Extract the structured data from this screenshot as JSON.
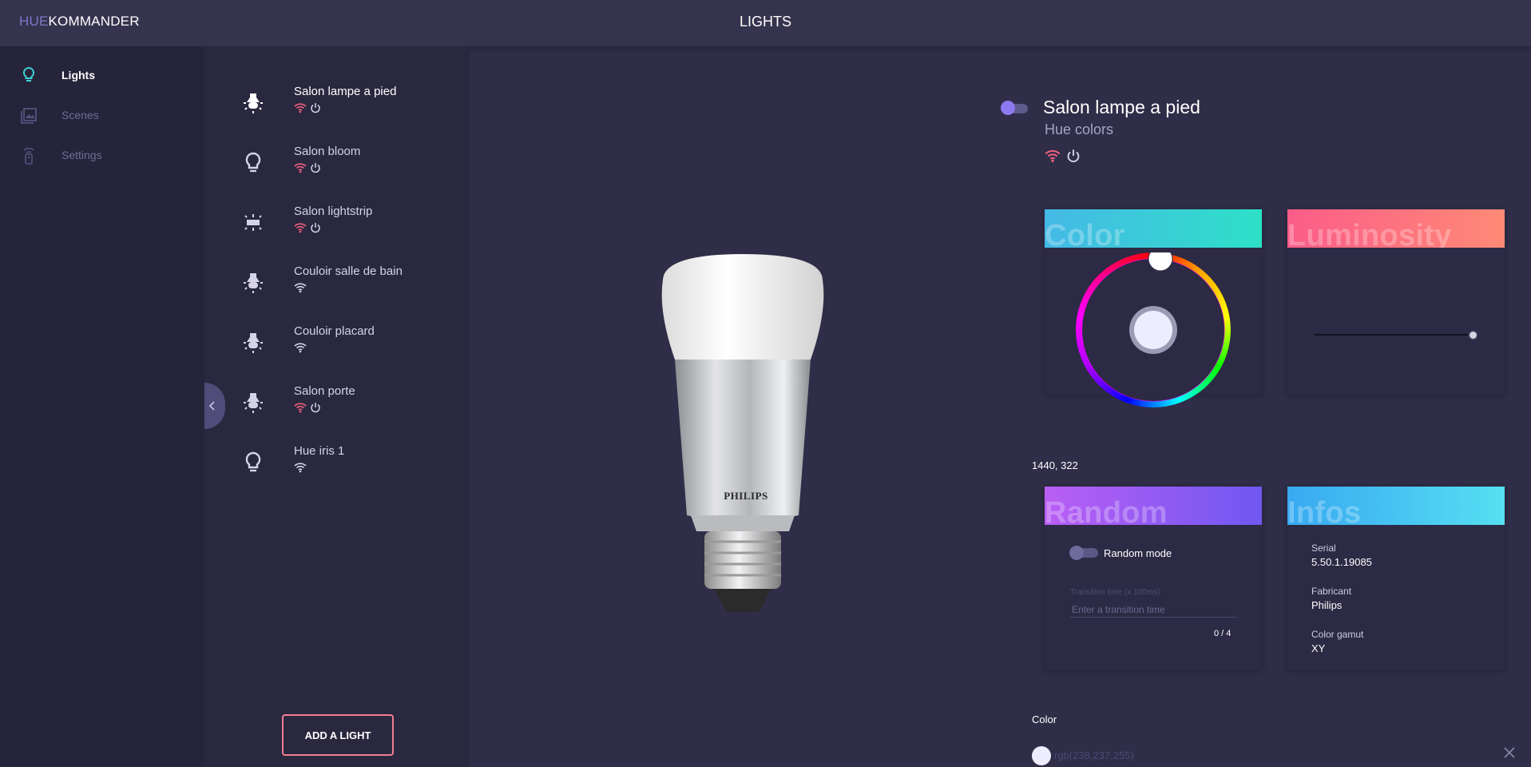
{
  "brand": {
    "prefix": "HUE",
    "name": "KOMMANDER"
  },
  "page_title": "LIGHTS",
  "nav": [
    {
      "label": "Lights",
      "icon": "bulb-icon",
      "active": true
    },
    {
      "label": "Scenes",
      "icon": "image-icon",
      "active": false
    },
    {
      "label": "Settings",
      "icon": "remote-icon",
      "active": false
    }
  ],
  "lights": [
    {
      "name": "Salon lampe a pied",
      "icon": "spot-bulb-icon",
      "reachable": false,
      "power": true
    },
    {
      "name": "Salon bloom",
      "icon": "bulb-outline-icon",
      "reachable": false,
      "power": true
    },
    {
      "name": "Salon lightstrip",
      "icon": "lightstrip-icon",
      "reachable": false,
      "power": true
    },
    {
      "name": "Couloir salle de bain",
      "icon": "spot-bulb-icon",
      "reachable": true,
      "power": false
    },
    {
      "name": "Couloir placard",
      "icon": "spot-bulb-icon",
      "reachable": true,
      "power": false
    },
    {
      "name": "Salon porte",
      "icon": "spot-bulb-icon",
      "reachable": false,
      "power": true
    },
    {
      "name": "Hue iris 1",
      "icon": "bulb-outline-icon",
      "reachable": true,
      "power": false
    }
  ],
  "add_light_label": "ADD A LIGHT",
  "bulb_brand": "PHILIPS",
  "detail": {
    "name": "Salon lampe a pied",
    "type": "Hue colors",
    "on": true
  },
  "cards": {
    "color_title": "Color",
    "luminosity_title": "Luminosity",
    "luminosity_level": 0.97,
    "random_title": "Random",
    "infos_title": "Infos"
  },
  "coords": "1440, 322",
  "random": {
    "mode_label": "Random mode",
    "enabled": false,
    "transition_label": "Transition time (x 100ms)",
    "transition_placeholder": "Enter a transition time",
    "counter": "0 / 4"
  },
  "infos": [
    {
      "label": "Serial",
      "value": "5.50.1.19085"
    },
    {
      "label": "Fabricant",
      "value": "Philips"
    },
    {
      "label": "Color gamut",
      "value": "XY"
    }
  ],
  "color_section": {
    "label": "Color",
    "value": "rgb(238,237,255)",
    "swatch": "#eeedff"
  },
  "colors": {
    "accent": "#8e79f0",
    "alert": "#f0607c",
    "background": "#2f2d47"
  }
}
